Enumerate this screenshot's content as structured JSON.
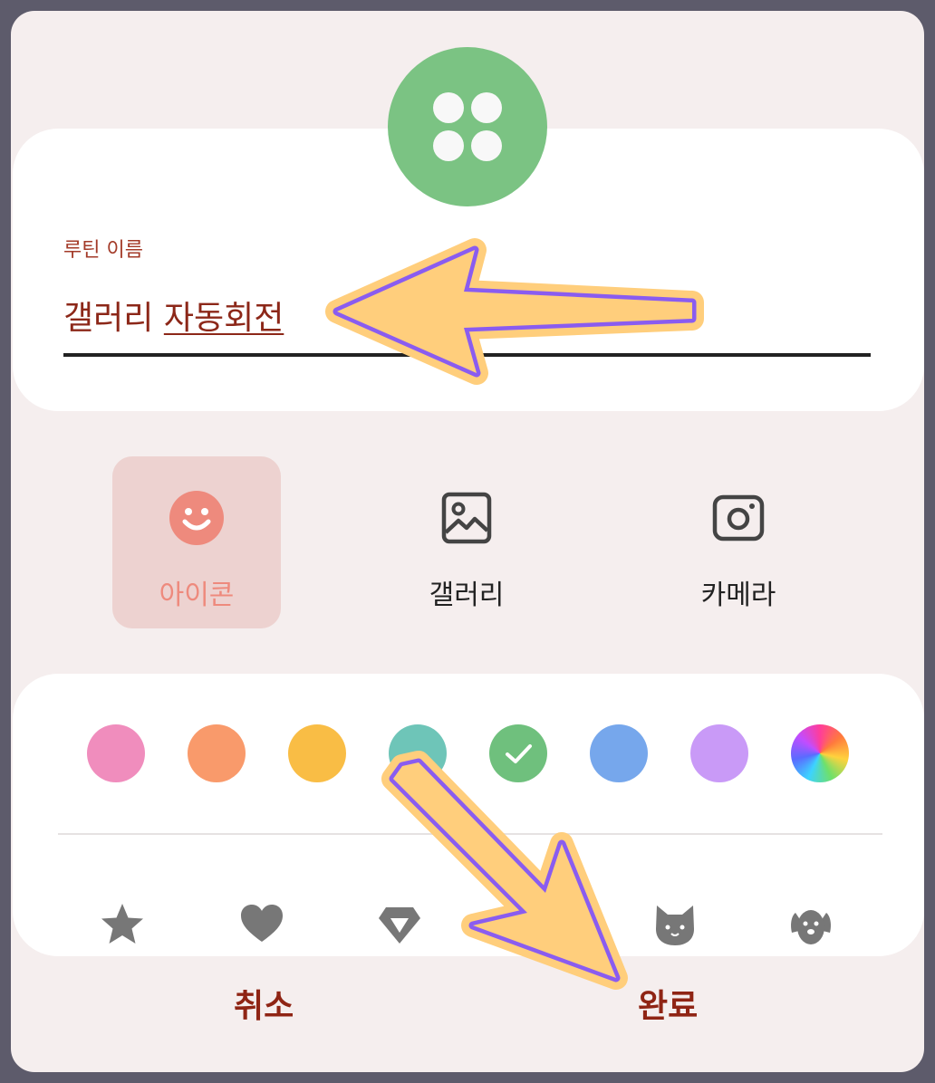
{
  "name_field": {
    "label": "루틴 이름",
    "value_plain": "갤러리",
    "value_underlined": "자동회전"
  },
  "image_sources": [
    {
      "label": "아이콘",
      "icon": "smiley-icon",
      "selected": true
    },
    {
      "label": "갤러리",
      "icon": "gallery-icon",
      "selected": false
    },
    {
      "label": "카메라",
      "icon": "camera-icon",
      "selected": false
    }
  ],
  "colors": {
    "avatar": "#7bc383",
    "selected_tab_bg": "#edd2d0",
    "accent_text": "#8f2414",
    "swatches": [
      "#f08dbd",
      "#f99a6b",
      "#f9bd45",
      "#6ec5b8",
      "#6fc07d",
      "#76a7ec",
      "#c99af7",
      "multicolor"
    ],
    "selected_swatch_index": 4
  },
  "shape_icons": [
    "star-icon",
    "heart-icon",
    "diamond-icon",
    "cat-icon",
    "dog-icon"
  ],
  "actions": {
    "cancel": "취소",
    "done": "완료"
  }
}
